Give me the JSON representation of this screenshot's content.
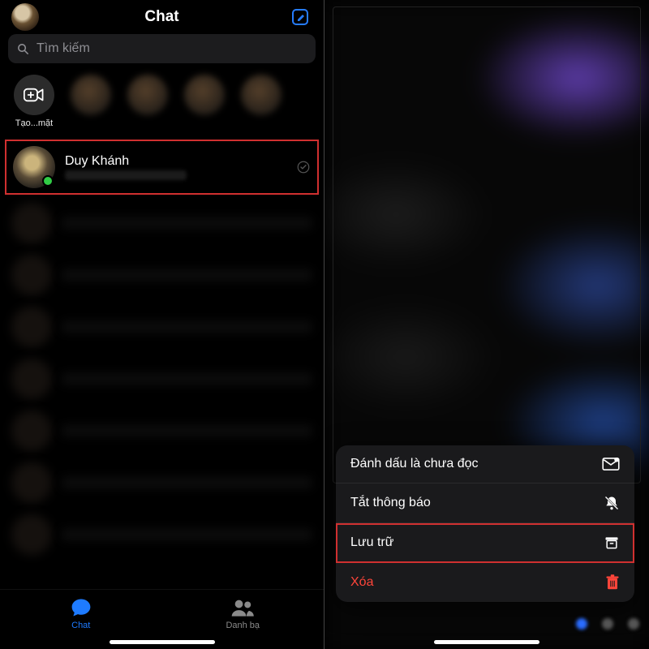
{
  "header": {
    "title": "Chat"
  },
  "search": {
    "placeholder": "Tìm kiếm"
  },
  "stories": {
    "create_label": "Tạo...mặt"
  },
  "chat": {
    "items": [
      {
        "name": "Duy Khánh"
      }
    ]
  },
  "tabs": {
    "chat": "Chat",
    "contacts": "Danh bạ"
  },
  "context_menu": {
    "mark_unread": "Đánh dấu là chưa đọc",
    "mute": "Tắt thông báo",
    "archive": "Lưu trữ",
    "delete": "Xóa"
  }
}
